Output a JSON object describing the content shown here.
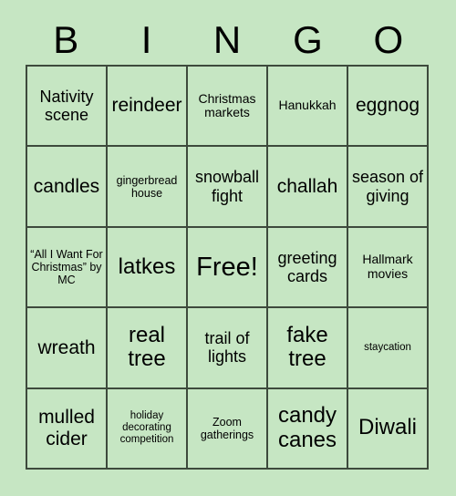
{
  "card": {
    "title": "BINGO",
    "header_letters": [
      "B",
      "I",
      "N",
      "G",
      "O"
    ],
    "colors": {
      "background": "#c6e6c3",
      "cell_background": "#c6e6c3",
      "grid_line": "#3d4a3c",
      "text": "#000000"
    },
    "grid": {
      "columns": 5,
      "rows": 5,
      "free_space_index": 12
    },
    "cells": [
      {
        "text": "Nativity scene",
        "size": "md"
      },
      {
        "text": "reindeer",
        "size": "lg"
      },
      {
        "text": "Christmas markets",
        "size": "sm"
      },
      {
        "text": "Hanukkah",
        "size": "sm"
      },
      {
        "text": "eggnog",
        "size": "lg"
      },
      {
        "text": "candles",
        "size": "lg"
      },
      {
        "text": "gingerbread house",
        "size": "xs"
      },
      {
        "text": "snowball fight",
        "size": "md"
      },
      {
        "text": "challah",
        "size": "lg"
      },
      {
        "text": "season of giving",
        "size": "md"
      },
      {
        "text": "“All I Want For Christmas” by MC",
        "size": "xs"
      },
      {
        "text": "latkes",
        "size": "xl"
      },
      {
        "text": "Free!",
        "size": "xxl"
      },
      {
        "text": "greeting cards",
        "size": "md"
      },
      {
        "text": "Hallmark movies",
        "size": "sm"
      },
      {
        "text": "wreath",
        "size": "lg"
      },
      {
        "text": "real tree",
        "size": "xl"
      },
      {
        "text": "trail of lights",
        "size": "md"
      },
      {
        "text": "fake tree",
        "size": "xl"
      },
      {
        "text": "staycation",
        "size": "xxs"
      },
      {
        "text": "mulled cider",
        "size": "lg"
      },
      {
        "text": "holiday decorating competition",
        "size": "xxs"
      },
      {
        "text": "Zoom gatherings",
        "size": "xs"
      },
      {
        "text": "candy canes",
        "size": "xl"
      },
      {
        "text": "Diwali",
        "size": "xl"
      }
    ]
  }
}
